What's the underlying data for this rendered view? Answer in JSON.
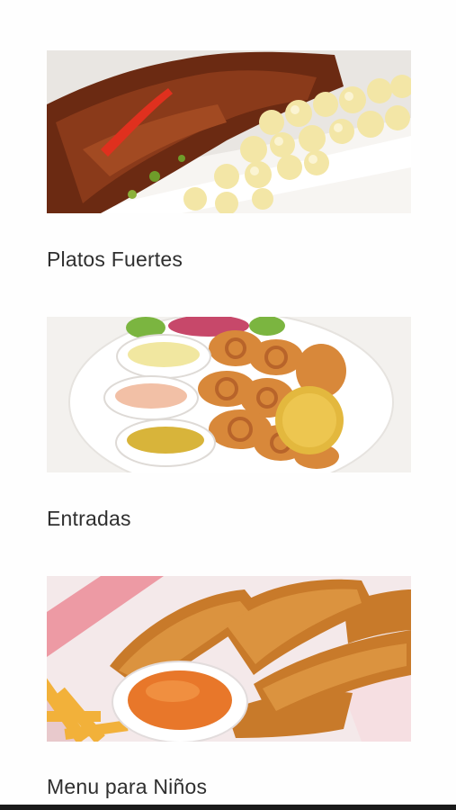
{
  "categories": [
    {
      "label": "Platos Fuertes",
      "image": "beef-with-potatoes-photo"
    },
    {
      "label": "Entradas",
      "image": "fried-seafood-with-sauces-photo"
    },
    {
      "label": "Menu para Niños",
      "image": "chicken-tenders-with-fries-photo"
    }
  ]
}
